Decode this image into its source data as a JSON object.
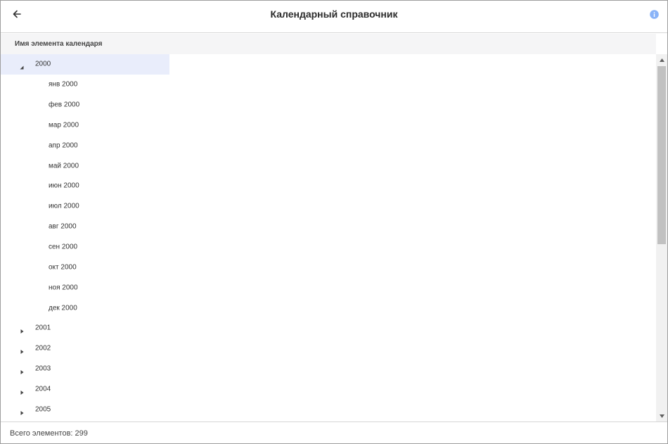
{
  "header": {
    "title": "Календарный справочник",
    "back_icon": "arrow-left-icon",
    "info_icon": "info-circle-icon",
    "info_color": "#8ab4f8"
  },
  "table": {
    "column_header": "Имя элемента календаря"
  },
  "tree": {
    "selected_color": "#e9edfb",
    "rows": [
      {
        "label": "2000",
        "level": 0,
        "expanded": true,
        "selected": true
      },
      {
        "label": "янв 2000",
        "level": 1
      },
      {
        "label": "фев 2000",
        "level": 1
      },
      {
        "label": "мар 2000",
        "level": 1
      },
      {
        "label": "апр 2000",
        "level": 1
      },
      {
        "label": "май 2000",
        "level": 1
      },
      {
        "label": "июн 2000",
        "level": 1
      },
      {
        "label": "июл 2000",
        "level": 1
      },
      {
        "label": "авг 2000",
        "level": 1
      },
      {
        "label": "сен 2000",
        "level": 1
      },
      {
        "label": "окт 2000",
        "level": 1
      },
      {
        "label": "ноя 2000",
        "level": 1
      },
      {
        "label": "дек 2000",
        "level": 1
      },
      {
        "label": "2001",
        "level": 0,
        "expanded": false
      },
      {
        "label": "2002",
        "level": 0,
        "expanded": false
      },
      {
        "label": "2003",
        "level": 0,
        "expanded": false
      },
      {
        "label": "2004",
        "level": 0,
        "expanded": false
      },
      {
        "label": "2005",
        "level": 0,
        "expanded": false
      }
    ]
  },
  "footer": {
    "total_text": "Всего элементов: 299"
  }
}
